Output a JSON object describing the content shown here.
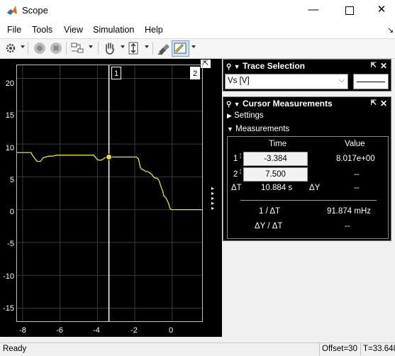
{
  "window": {
    "title": "Scope",
    "minimize_glyph": "—",
    "maximize_glyph": "☐",
    "close_glyph": "✕"
  },
  "menu": {
    "items": [
      "File",
      "Tools",
      "View",
      "Simulation",
      "Help"
    ],
    "corner_arrow": "↘"
  },
  "toolbar": {
    "icons": [
      "gear-icon",
      "run-icon",
      "stop-icon",
      "signal-select-icon",
      "pan-hand-icon",
      "zoom-axes-icon",
      "highlight-icon",
      "cursor-measure-icon"
    ]
  },
  "plot": {
    "y_ticks": [
      "20",
      "15",
      "10",
      "5",
      "0",
      "-5",
      "-10",
      "-15"
    ],
    "x_ticks": [
      "-8",
      "-6",
      "-4",
      "-2",
      "0"
    ],
    "cursor1_label": "1",
    "cursor2_label": "2",
    "expand_glyph": "⇱",
    "side_arrows": "▸",
    "line_color": "#e8e23a",
    "cursor_color": "#ffffff",
    "bg_color": "#000000"
  },
  "chart_data": {
    "type": "line",
    "xlim": [
      -8.3,
      1.6
    ],
    "ylim": [
      -17,
      22
    ],
    "grid": true,
    "series": [
      {
        "x": [
          -8.3,
          -7.55,
          -7.48,
          -7.35,
          -7.25,
          -7.15,
          -7.05,
          -6.9,
          -6.8,
          -6.6,
          -6.4,
          -6.2,
          -6.0,
          -5.8,
          -5.6,
          -5.4,
          -5.2,
          -5.0,
          -4.8,
          -4.6,
          -4.4,
          -4.2,
          -4.0,
          -3.9,
          -3.8,
          -3.7,
          -3.6,
          -3.5,
          -3.384,
          -3.2,
          -3.0,
          -2.8,
          -2.6,
          -2.4,
          -2.2,
          -2.0,
          -1.9,
          -1.8,
          -1.7,
          -1.6,
          -1.5,
          -1.4,
          -1.3,
          -1.2,
          -1.1,
          -1.0,
          -0.9,
          -0.8,
          -0.7,
          -0.6,
          -0.5,
          -0.45,
          -0.4,
          -0.3,
          -0.2,
          -0.15,
          -0.1,
          0.0,
          0.1,
          0.3,
          0.6,
          0.9,
          1.2,
          1.6
        ],
        "y": [
          8.7,
          8.7,
          8.3,
          7.8,
          7.4,
          7.35,
          7.35,
          7.9,
          8.0,
          8.15,
          8.15,
          8.3,
          8.3,
          8.3,
          8.3,
          8.3,
          8.3,
          8.3,
          8.3,
          8.3,
          8.3,
          8.3,
          7.6,
          7.55,
          7.55,
          7.7,
          7.9,
          8.0,
          8.017,
          8.017,
          8.017,
          8.017,
          8.017,
          8.017,
          8.017,
          8.017,
          8.017,
          7.7,
          6.4,
          6.1,
          6.0,
          5.8,
          5.8,
          5.6,
          5.4,
          5.0,
          4.8,
          4.8,
          4.4,
          3.5,
          2.8,
          2.1,
          2.0,
          1.6,
          1.0,
          0.5,
          0.1,
          0.0,
          0.0,
          0.0,
          0.0,
          0.0,
          0.0,
          0.0
        ]
      }
    ],
    "cursors": {
      "cursor1_time": -3.384,
      "cursor1_value": 8.017
    }
  },
  "trace_selection": {
    "title": "Trace Selection",
    "signal": "Vs [V]",
    "pin_glyph": "⇱",
    "close_glyph": "✕"
  },
  "cursor_measurements": {
    "title": "Cursor Measurements",
    "settings_label": "Settings",
    "measurements_label": "Measurements",
    "col_time": "Time",
    "col_value": "Value",
    "row1_label": "1",
    "row1_time": "-3.384",
    "row1_value": "8.017e+00",
    "row2_label": "2",
    "row2_time": "7.500",
    "row2_value": "--",
    "dt_label": "ΔT",
    "dt_value": "10.884 s",
    "dy_label": "ΔY",
    "dy_value": "--",
    "inv_dt_label": "1 / ΔT",
    "inv_dt_value": "91.874 mHz",
    "dydt_label": "ΔY / ΔT",
    "dydt_value": "--"
  },
  "status": {
    "text": "Ready",
    "offset": "Offset=30",
    "time": "T=33.648"
  }
}
